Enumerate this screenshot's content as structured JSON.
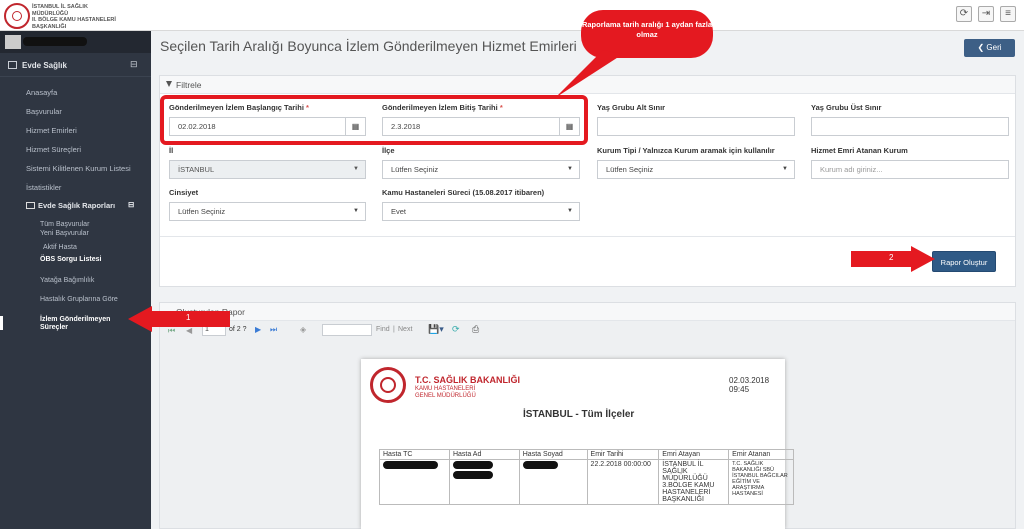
{
  "header": {
    "org_line1": "İSTANBUL İL SAĞLIK MÜDÜRLÜĞÜ",
    "org_line2": "II. BÖLGE KAMU HASTANELERİ",
    "org_line3": "BAŞKANLIĞI"
  },
  "sidebar": {
    "section": "Evde Sağlık",
    "items": [
      "Anasayfa",
      "Başvurular",
      "Hizmet Emirleri",
      "Hizmet Süreçleri",
      "Sistemi Kilitlenen Kurum Listesi",
      "İstatistikler"
    ],
    "reports_header": "Evde Sağlık Raporları",
    "sub_items": [
      "Tüm Başvurular",
      "Yeni Başvurular",
      "Aktif Hasta",
      "ÖBS Sorgu Listesi"
    ],
    "items2": [
      "Yatağa Bağımlılık",
      "Hastalık Gruplarına Göre",
      "İzlem Gönderilmeyen",
      "Süreçler"
    ]
  },
  "page": {
    "title": "Seçilen Tarih Aralığı Boyunca İzlem Gönderilmeyen Hizmet Emirleri",
    "back": "Geri"
  },
  "filter": {
    "header": "Filtrele",
    "start_label": "Gönderilmeyen İzlem Başlangıç Tarihi",
    "start_value": "02.02.2018",
    "end_label": "Gönderilmeyen İzlem Bitiş Tarihi",
    "end_value": "2.3.2018",
    "age_min_label": "Yaş Grubu Alt Sınır",
    "age_max_label": "Yaş Grubu Üst Sınır",
    "il_label": "İl",
    "il_value": "İSTANBUL",
    "ilce_label": "İlçe",
    "ilce_value": "Lütfen Seçiniz",
    "kurum_tipi_label": "Kurum Tipi / Yalnızca Kurum aramak için kullanılır",
    "kurum_tipi_value": "Lütfen Seçiniz",
    "atanan_label": "Hizmet Emri Atanan Kurum",
    "atanan_placeholder": "Kurum adı giriniz...",
    "cinsiyet_label": "Cinsiyet",
    "cinsiyet_value": "Lütfen Seçiniz",
    "kamu_label": "Kamu Hastaneleri Süreci (15.08.2017 itibaren)",
    "kamu_value": "Evet",
    "req": "*",
    "rapor_button": "Rapor Oluştur"
  },
  "annotations": {
    "bubble": "Raporlama tarih aralığı 1 aydan fazla olmaz",
    "arrow1": "1",
    "arrow2": "2"
  },
  "report": {
    "header": "Oluşturulan Rapor",
    "toolbar": {
      "page": "1",
      "of": "of 2 ?",
      "find": "Find",
      "next": "Next",
      "sep": "|"
    },
    "ministry": "T.C. SAĞLIK BAKANLIĞI",
    "ministry_sub1": "KAMU HASTANELERİ",
    "ministry_sub2": "GENEL MÜDÜRLÜĞÜ",
    "datetime": "02.03.2018 09:45",
    "subtitle": "İSTANBUL - Tüm İlçeler",
    "columns": [
      "Hasta TC",
      "Hasta Ad",
      "Hasta Soyad",
      "Emir Tarihi",
      "Emri Atayan",
      "Emir Atanan"
    ],
    "row": {
      "emir_tarihi": "22.2.2018 00:00:00",
      "atayan": "İSTANBUL İL SAĞLIK MÜDÜRLÜĞÜ 3.BÖLGE KAMU HASTANELERİ BAŞKANLIĞI",
      "atanan": "T.C. SAĞLIK BAKANLIĞI SBÜ İSTANBUL BAĞCILAR EĞİTİM VE ARAŞTIRMA HASTANESİ"
    }
  },
  "colors": {
    "sidebar": "#2f3642",
    "accent": "#2f5a86",
    "annotation": "#e41920"
  }
}
